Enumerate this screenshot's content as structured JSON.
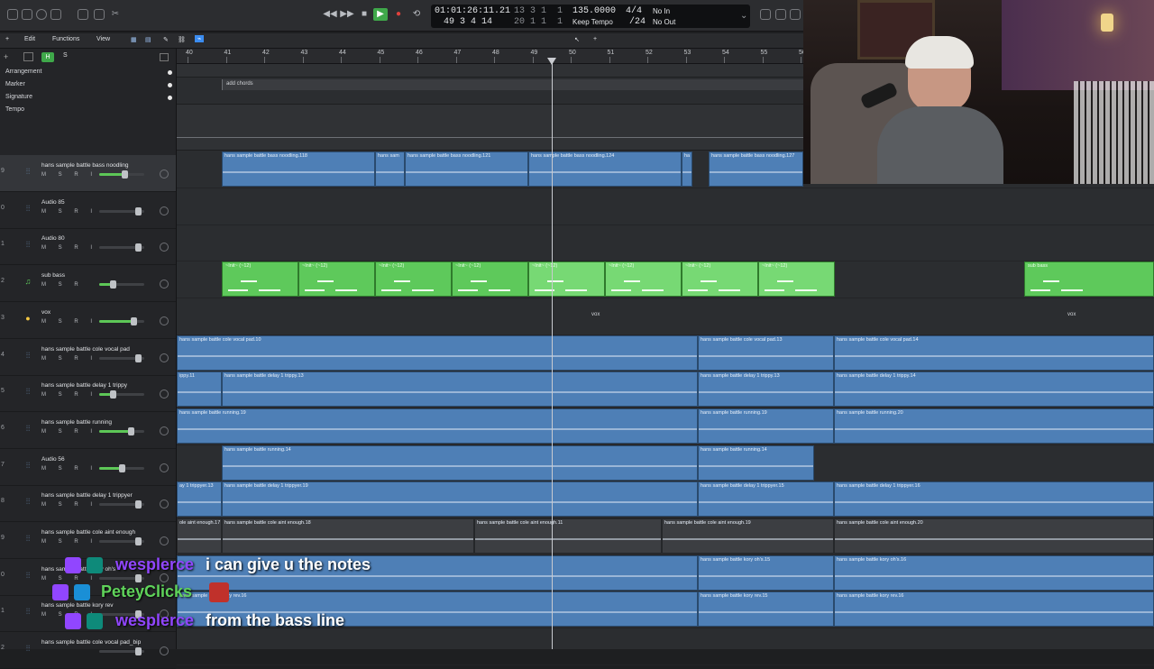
{
  "transport": {
    "time_top": "01:01:26:11.21",
    "time_bottom": "49 3 4 14",
    "pos_top": "13 3 1",
    "pos_top_b": "1",
    "pos_bottom": "20 1 1",
    "pos_bottom_b": "1",
    "tempo": "135.0000",
    "tempo_label": "Keep Tempo",
    "signature": "4/4",
    "division": "/24",
    "in_label": "No In",
    "out_label": "No Out"
  },
  "control_bar": {
    "edit": "Edit",
    "functions": "Functions",
    "view": "View"
  },
  "header": {
    "h_button": "H",
    "s_button": "S"
  },
  "global_tracks": [
    "Arrangement",
    "Marker",
    "Signature",
    "Tempo"
  ],
  "arrangement_marker": "add chords",
  "ruler": [
    "40",
    "41",
    "42",
    "43",
    "44",
    "45",
    "46",
    "47",
    "48",
    "49",
    "50",
    "51",
    "52",
    "53",
    "54",
    "55",
    "56"
  ],
  "tracks": [
    {
      "num": "9",
      "name": "hans sample battle bass noodling",
      "buttons": "M S R I",
      "level": 0.55,
      "icon": "waveform-icon"
    },
    {
      "num": "0",
      "name": "Audio 85",
      "buttons": "M S R I",
      "level": 0.0,
      "icon": "waveform-icon"
    },
    {
      "num": "1",
      "name": "Audio 80",
      "buttons": "M S R I",
      "level": 0.0,
      "icon": "waveform-icon"
    },
    {
      "num": "2",
      "name": "sub bass",
      "buttons": "M S R",
      "level": 0.3,
      "icon": "midi-note-icon"
    },
    {
      "num": "3",
      "name": "vox",
      "buttons": "M S R I",
      "level": 0.75,
      "icon": "folder-icon"
    },
    {
      "num": "4",
      "name": "hans sample battle cole vocal pad",
      "buttons": "M S R I",
      "level": 0.0,
      "icon": "waveform-icon"
    },
    {
      "num": "5",
      "name": "hans sample battle delay 1 trippy",
      "buttons": "M S R I",
      "level": 0.3,
      "icon": "waveform-icon"
    },
    {
      "num": "6",
      "name": "hans sample battle running",
      "buttons": "M S R I",
      "level": 0.7,
      "icon": "waveform-icon"
    },
    {
      "num": "7",
      "name": "Audio 56",
      "buttons": "M S R I",
      "level": 0.5,
      "icon": "waveform-icon"
    },
    {
      "num": "8",
      "name": "hans sample battle delay 1 trippyer",
      "buttons": "M S R I",
      "level": 0.0,
      "icon": "waveform-icon"
    },
    {
      "num": "9",
      "name": "hans sample battle cole aint enough",
      "buttons": "M S R I",
      "level": 0.0,
      "icon": "waveform-icon"
    },
    {
      "num": "0",
      "name": "hans sample battle kory oh's",
      "buttons": "M S R I",
      "level": 0.0,
      "icon": "waveform-icon"
    },
    {
      "num": "1",
      "name": "hans sample battle kory rev",
      "buttons": "M S R I",
      "level": 0.0,
      "icon": "waveform-icon"
    },
    {
      "num": "2",
      "name": "hans sample battle cole vocal pad_bip",
      "buttons": "",
      "level": 0.0,
      "icon": "waveform-icon"
    }
  ],
  "regions": {
    "bass_noodling": [
      "hans sample battle bass noodling.118",
      "hans sam",
      "hans sample battle bass noodling.121",
      "hans sample battle bass noodling.124",
      "ha",
      "hans sample battle bass noodling.127"
    ],
    "sub_bass_label": "~Init~ (~12)",
    "sub_bass_end": "sub bass",
    "vox_folder": "vox",
    "vocal_pad": [
      "hans sample battle cole vocal pad.10",
      "hans sample battle cole vocal pad.13",
      "hans sample battle cole vocal pad.14"
    ],
    "delay_trippy": [
      "ippy.11",
      "hans sample battle delay 1 trippy.13",
      "hans sample battle delay 1 trippy.13",
      "hans sample battle delay 1 trippy.14"
    ],
    "running": [
      "hans sample battle running.19",
      "hans sample battle running.19",
      "hans sample battle running.20"
    ],
    "audio56": [
      "hans sample battle running.14",
      "hans sample battle running.14"
    ],
    "trippyer": [
      "ay 1 trippyer.13",
      "hans sample battle delay 1 trippyer.19",
      "hans sample battle delay 1 trippyer.15",
      "hans sample battle delay 1 trippyer.16"
    ],
    "aint_enough": [
      "ole aint enough.17",
      "hans sample battle cole aint enough.18",
      "hans sample battle cole aint enough.11",
      "hans sample battle cole aint enough.19",
      "hans sample battle cole aint enough.20"
    ],
    "kory_ohs": [
      "hans sample battle kory oh's.15",
      "hans sample battle kory oh's.16"
    ],
    "kory_rev": [
      "hans sample battle kory rev.16",
      "hans sample battle kory rev.15",
      "hans sample battle kory rev.16"
    ]
  },
  "chat": [
    {
      "user": "wesplerce",
      "message": "i can give u the notes",
      "user_color": "#9146ff"
    },
    {
      "user": "PeteyClicks",
      "message": "",
      "user_color": "#5fd35a"
    },
    {
      "user": "wesplerce",
      "message": "from the bass line",
      "user_color": "#9146ff"
    }
  ],
  "colors": {
    "audio_region": "#4e7fb6",
    "midi_region": "#5ec95b",
    "accent": "#3b8cf0"
  }
}
